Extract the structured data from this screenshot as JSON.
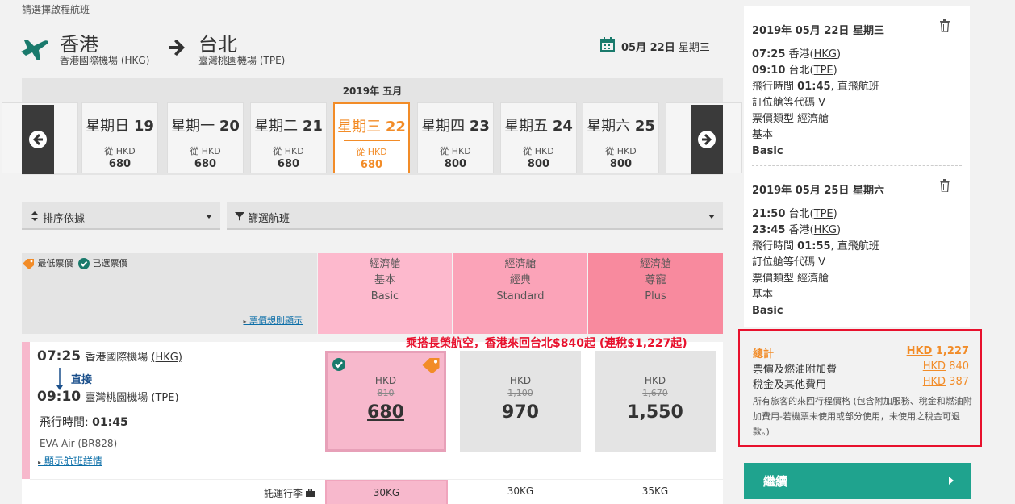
{
  "instruction": "請選擇啟程航班",
  "route": {
    "origin_city": "香港",
    "origin_airport": "香港國際機場 (HKG)",
    "destination_city": "台北",
    "destination_airport": "臺灣桃園機場 (TPE)",
    "date_month_day": "05月 22日",
    "date_weekday": "星期三"
  },
  "carousel": {
    "month": "2019年 五月",
    "days": [
      {
        "name": "星期日",
        "day": "19",
        "from": "從 HKD",
        "price": "680"
      },
      {
        "name": "星期一",
        "day": "20",
        "from": "從 HKD",
        "price": "680"
      },
      {
        "name": "星期二",
        "day": "21",
        "from": "從 HKD",
        "price": "680"
      },
      {
        "name": "星期三",
        "day": "22",
        "from": "從 HKD",
        "price": "680"
      },
      {
        "name": "星期四",
        "day": "23",
        "from": "從 HKD",
        "price": "800"
      },
      {
        "name": "星期五",
        "day": "24",
        "from": "從 HKD",
        "price": "800"
      },
      {
        "name": "星期六",
        "day": "25",
        "from": "從 HKD",
        "price": "800"
      }
    ]
  },
  "sort_label": "排序依據",
  "filter_label": "篩選航班",
  "legend": {
    "lowest": "最低票價",
    "selected": "已選票價"
  },
  "fare_rules_link": "票價規則顯示",
  "fare_columns": [
    {
      "cabin": "經濟艙",
      "name_zh": "基本",
      "name_en": "Basic",
      "color": "#fdb9cd"
    },
    {
      "cabin": "經濟艙",
      "name_zh": "經典",
      "name_en": "Standard",
      "color": "#fba3b8"
    },
    {
      "cabin": "經濟艙",
      "name_zh": "尊寵",
      "name_en": "Plus",
      "color": "#f88a9e"
    }
  ],
  "promo": "乘搭長榮航空，香港來回台北$840起 (連稅$1,227起)",
  "flight": {
    "dep_time": "07:25",
    "dep_airport_name": "香港國際機場",
    "dep_code": "(HKG)",
    "stops": "直接",
    "arr_time": "09:10",
    "arr_airport_name": "臺灣桃園機場",
    "arr_code": "(TPE)",
    "duration_label": "飛行時間:",
    "duration": "01:45",
    "airline": "EVA Air (BR828)",
    "details_link": "顯示航班詳情",
    "fares": [
      {
        "currency": "HKD",
        "old": "810",
        "price": "680"
      },
      {
        "currency": "HKD",
        "old": "1,100",
        "price": "970"
      },
      {
        "currency": "HKD",
        "old": "1,670",
        "price": "1,550"
      }
    ],
    "baggage_label": "託運行李",
    "baggage": [
      "30KG",
      "30KG",
      "35KG"
    ]
  },
  "summary": {
    "legs": [
      {
        "date": "2019年 05月 22日 星期三",
        "dep_time": "07:25",
        "dep_city": "香港",
        "dep_code": "HKG",
        "arr_time": "09:10",
        "arr_city": "台北",
        "arr_code": "TPE",
        "duration_prefix": "飛行時間",
        "duration": "01:45",
        "duration_suffix": ", 直飛航班",
        "booking_class": "訂位艙等代碼 V",
        "fare_type": "票價類型 經濟艙",
        "fare_zh": "基本",
        "fare_en": "Basic"
      },
      {
        "date": "2019年 05月 25日 星期六",
        "dep_time": "21:50",
        "dep_city": "台北",
        "dep_code": "TPE",
        "arr_time": "23:45",
        "arr_city": "香港",
        "arr_code": "HKG",
        "duration_prefix": "飛行時間",
        "duration": "01:55",
        "duration_suffix": ", 直飛航班",
        "booking_class": "訂位艙等代碼 V",
        "fare_type": "票價類型 經濟艙",
        "fare_zh": "基本",
        "fare_en": "Basic"
      }
    ],
    "total_label": "總計",
    "total_currency": "HKD",
    "total_value": "1,227",
    "fare_label": "票價及燃油附加費",
    "fare_currency": "HKD",
    "fare_value": "840",
    "tax_label": "稅金及其他費用",
    "tax_currency": "HKD",
    "tax_value": "387",
    "note": "所有旅客的來回行程價格 (包含附加服務、稅金和燃油附加費用-若機票未使用或部分使用，未使用之稅金可退款。)",
    "continue_label": "繼續"
  },
  "colors": {
    "accent_orange": "#f28c28",
    "teal": "#1fa38e",
    "promo_red": "#e8112d",
    "selected_pink": "#f7b8cc"
  }
}
